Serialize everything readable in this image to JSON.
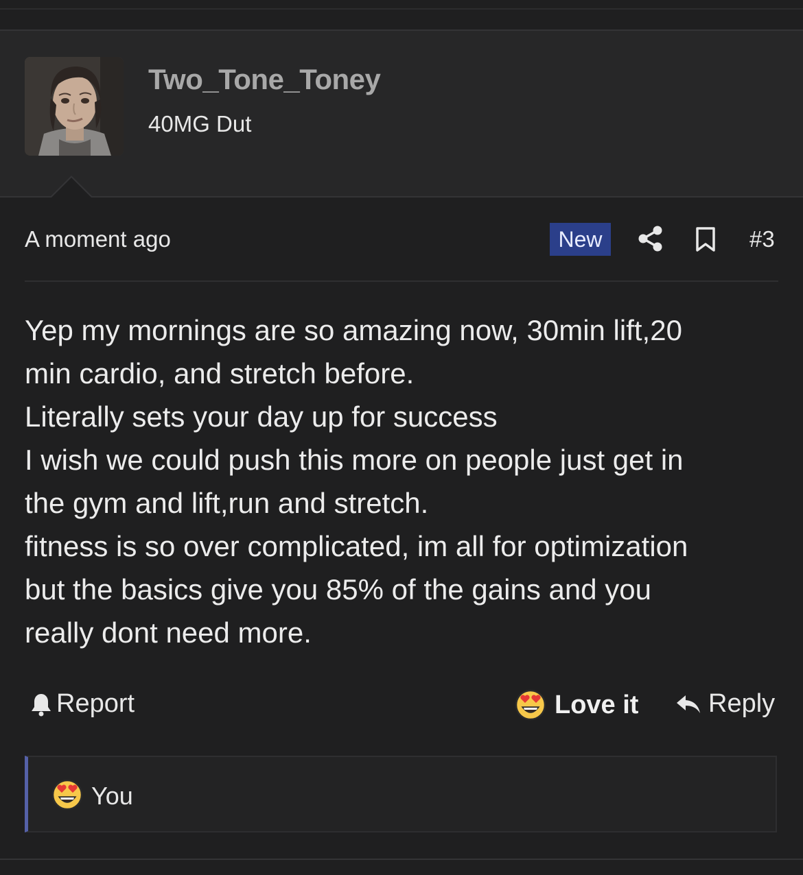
{
  "post": {
    "author": {
      "username": "Two_Tone_Toney",
      "user_title": "40MG Dut"
    },
    "meta": {
      "time": "A moment ago",
      "badge": "New",
      "post_number": "#3"
    },
    "body_lines": [
      "Yep my mornings are so amazing now, 30min lift,20",
      "min cardio, and stretch before.",
      "Literally sets your day up for success",
      "I wish we could push this more on people just get in",
      "the gym and lift,run and stretch.",
      "fitness is so over complicated, im all for optimization",
      "but the basics give you 85% of the gains and you",
      "really dont need more."
    ],
    "actions": {
      "report": "Report",
      "love": "Love it",
      "reply": "Reply"
    },
    "reactions": {
      "by": "You"
    }
  },
  "colors": {
    "background": "#1f1f20",
    "user_panel": "#272728",
    "badge_new": "#2b3f8a",
    "reaction_accent": "#5561a8"
  },
  "icons": [
    "share-icon",
    "bookmark-icon",
    "bell-icon",
    "heart-eyes-emoji",
    "reply-arrow-icon"
  ]
}
